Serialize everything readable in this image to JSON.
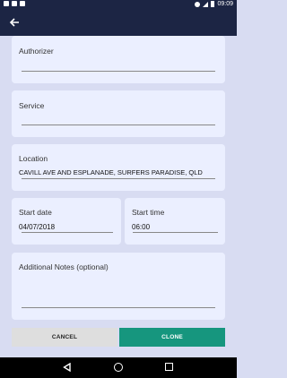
{
  "status_bar": {
    "time": "09:09"
  },
  "form": {
    "authorizer": {
      "label": "Authorizer",
      "value": ""
    },
    "service": {
      "label": "Service",
      "value": ""
    },
    "location": {
      "label": "Location",
      "value": "CAVILL AVE AND ESPLANADE, SURFERS PARADISE, QLD"
    },
    "start_date": {
      "label": "Start date",
      "value": "04/07/2018"
    },
    "start_time": {
      "label": "Start time",
      "value": "06:00"
    },
    "notes": {
      "label": "Additional Notes (optional)",
      "value": ""
    }
  },
  "buttons": {
    "cancel": "CANCEL",
    "clone": "CLONE"
  },
  "colors": {
    "app_bar": "#1c2544",
    "background": "#d8dcf2",
    "card": "#ebefff",
    "clone_button": "#16967e",
    "cancel_button": "#dedede"
  }
}
